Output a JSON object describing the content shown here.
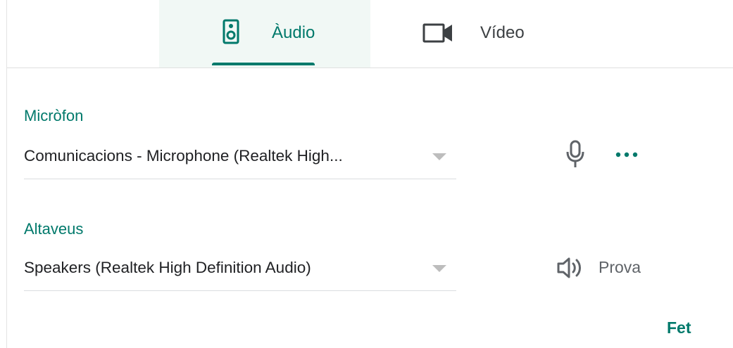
{
  "tabs": [
    {
      "label": "Àudio",
      "icon": "speaker-icon",
      "selected": true
    },
    {
      "label": "Vídeo",
      "icon": "videocam-icon",
      "selected": false
    }
  ],
  "microphone": {
    "label": "Micròfon",
    "value": "Comunicacions - Microphone (Realtek High...",
    "icon": "mic-icon",
    "more_icon": "more-horiz-icon"
  },
  "speakers": {
    "label": "Altaveus",
    "value": "Speakers (Realtek High Definition Audio)",
    "test_label": "Prova",
    "test_icon": "volume-icon"
  },
  "footer": {
    "done_label": "Fet"
  },
  "colors": {
    "accent": "#00796b",
    "selected_tab_bg": "#f1f8f5",
    "text": "#202124",
    "secondary_text": "#5f6368",
    "icon": "#5f6368",
    "divider": "#dadce0"
  }
}
